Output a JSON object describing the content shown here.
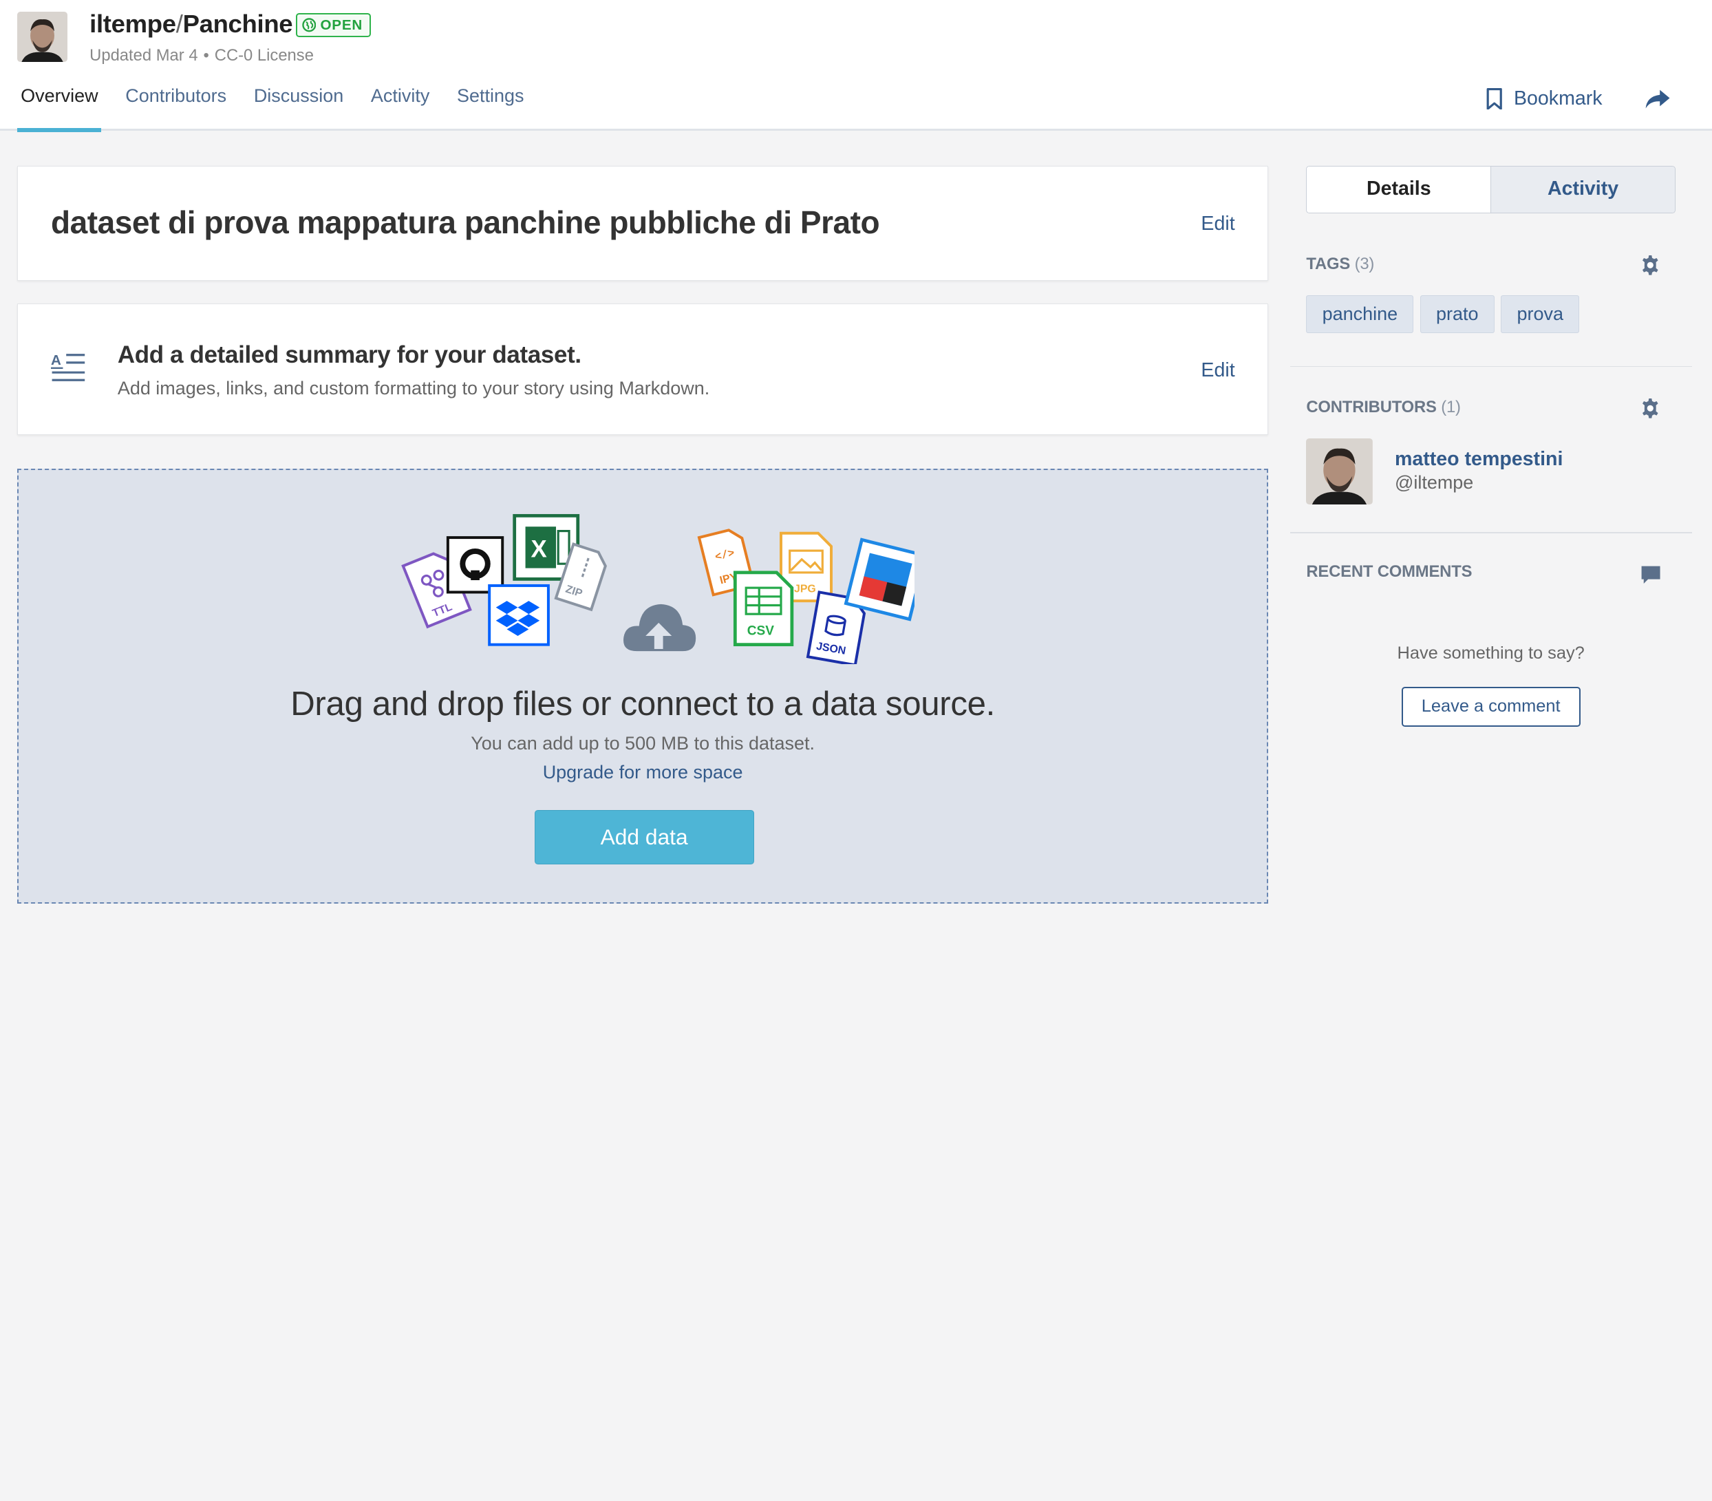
{
  "header": {
    "owner": "iltempe",
    "separator": "/",
    "dataset": "Panchine",
    "badge": "OPEN",
    "updated": "Updated Mar 4",
    "meta_dot": "•",
    "license": "CC-0 License"
  },
  "tabs": [
    {
      "label": "Overview",
      "active": true
    },
    {
      "label": "Contributors"
    },
    {
      "label": "Discussion"
    },
    {
      "label": "Activity"
    },
    {
      "label": "Settings"
    }
  ],
  "actions": {
    "bookmark": "Bookmark",
    "share_icon": "share-arrow-icon"
  },
  "title_card": {
    "title": "dataset di prova mappatura panchine pubbliche di Prato",
    "edit": "Edit"
  },
  "summary_card": {
    "heading": "Add a detailed summary for your dataset.",
    "text": "Add images, links, and custom formatting to your story using Markdown.",
    "edit": "Edit"
  },
  "dropzone": {
    "file_icons": [
      "TTL",
      "ZIP",
      "IPY",
      "JPG",
      "CSV",
      "JSON"
    ],
    "heading": "Drag and drop files or connect to a data source.",
    "limit": "You can add up to 500 MB to this dataset.",
    "upgrade": "Upgrade for more space",
    "button": "Add data"
  },
  "sidebar": {
    "tabs": {
      "details": "Details",
      "activity": "Activity"
    },
    "tags": {
      "label": "TAGS",
      "count": "(3)",
      "items": [
        "panchine",
        "prato",
        "prova"
      ]
    },
    "contributors": {
      "label": "CONTRIBUTORS",
      "count": "(1)",
      "name": "matteo tempestini",
      "handle": "@iltempe"
    },
    "comments": {
      "label": "RECENT COMMENTS",
      "prompt": "Have something to say?",
      "button": "Leave a comment"
    }
  },
  "colors": {
    "accent": "#4ab1d4",
    "link": "#335a8a",
    "open_badge": "#2eb34b",
    "dropzone_bg": "#dde2eb"
  }
}
